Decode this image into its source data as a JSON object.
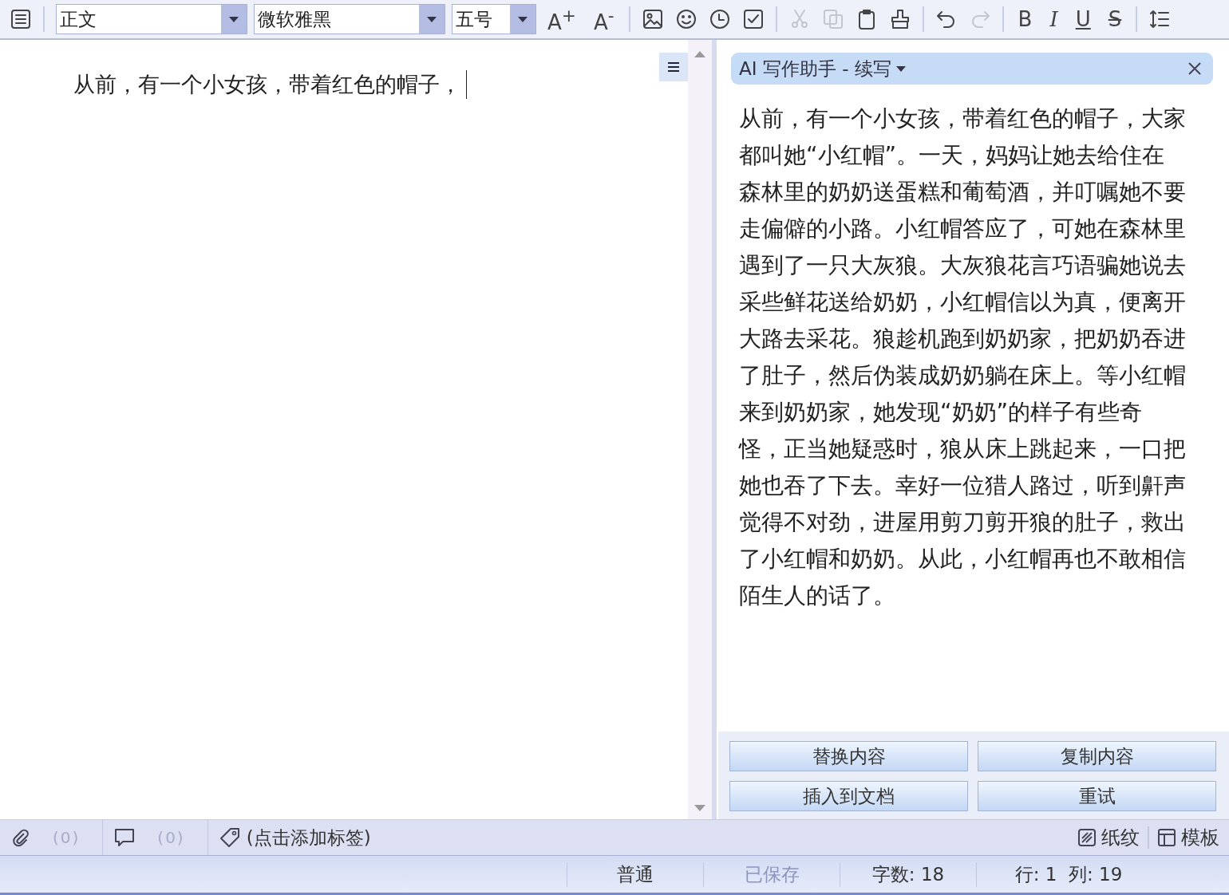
{
  "toolbar": {
    "groups": [
      [
        {
          "kind": "menu",
          "disabled": false
        }
      ],
      [
        {
          "kind": "dropdown",
          "value": "正文"
        },
        {
          "kind": "dropdown",
          "value": "微软雅黑"
        },
        {
          "kind": "dropdown",
          "value": "五号"
        },
        {
          "kind": "text",
          "label": "A$^{+}$",
          "disabled": false
        },
        {
          "kind": "text",
          "label": "A$^{-}$",
          "disabled": false
        }
      ],
      [
        {
          "kind": "image",
          "disabled": false
        },
        {
          "kind": "emoji",
          "disabled": false
        },
        {
          "kind": "clock",
          "disabled": false
        },
        {
          "kind": "checkbox",
          "disabled": false
        }
      ],
      [
        {
          "kind": "cut",
          "disabled": true
        },
        {
          "kind": "copy",
          "disabled": true
        },
        {
          "kind": "paste",
          "disabled": false
        },
        {
          "kind": "brush",
          "disabled": false
        }
      ],
      [
        {
          "kind": "undo",
          "disabled": false
        },
        {
          "kind": "redo",
          "disabled": true
        }
      ],
      [
        {
          "kind": "bold",
          "label": "B",
          "disabled": false
        },
        {
          "kind": "italic",
          "label": "I",
          "disabled": false
        },
        {
          "kind": "underline",
          "label": "U",
          "disabled": false
        },
        {
          "kind": "strike",
          "label": "S",
          "disabled": false
        }
      ],
      [
        {
          "kind": "linespacing",
          "disabled": false
        }
      ]
    ]
  },
  "editor": {
    "text": "从前，有一个小女孩，带着红色的帽子，"
  },
  "assistant": {
    "title": "AI 写作助手 - 续写",
    "body": "从前，有一个小女孩，带着红色的帽子，大家都叫她“小红帽”。一天，妈妈让她去给住在森林里的奶奶送蛋糕和葡萄酒，并叮嘱她不要走偏僻的小路。小红帽答应了，可她在森林里遇到了一只大灰狼。大灰狼花言巧语骗她说去采些鲜花送给奶奶，小红帽信以为真，便离开大路去采花。狼趁机跑到奶奶家，把奶奶吞进了肚子，然后伪装成奶奶躺在床上。等小红帽来到奶奶家，她发现“奶奶”的样子有些奇怪，正当她疑惑时，狼从床上跳起来，一口把她也吞了下去。幸好一位猎人路过，听到鼾声觉得不对劲，进屋用剪刀剪开狼的肚子，救出了小红帽和奶奶。从此，小红帽再也不敢相信陌生人的话了。",
    "buttons": [
      "替换内容",
      "复制内容",
      "插入到文档",
      "重试"
    ]
  },
  "footer": {
    "attachments": {
      "count": "(0)",
      "disabled": true
    },
    "comments": {
      "count": "(0)",
      "disabled": true
    },
    "tags": {
      "placeholder": "(点击添加标签)"
    },
    "right": [
      {
        "kind": "texture",
        "label": "纸纹"
      },
      {
        "kind": "template",
        "label": "模板"
      }
    ]
  },
  "status_bar": [
    {
      "text": "普通",
      "disabled": false
    },
    {
      "text": "已保存",
      "disabled": true
    },
    {
      "text": "字数: 18",
      "disabled": false
    },
    {
      "text": "行: 1  列: 19",
      "disabled": false
    }
  ]
}
